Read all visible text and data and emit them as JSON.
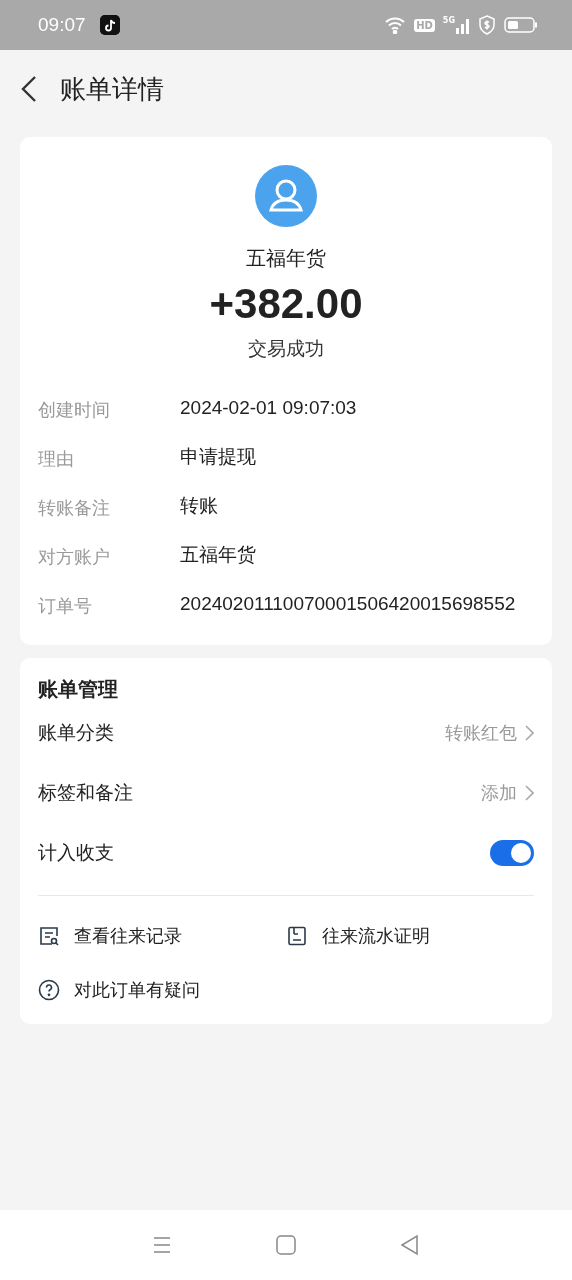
{
  "status_bar": {
    "time": "09:07",
    "hd_label": "HD",
    "network_label": "5G"
  },
  "header": {
    "title": "账单详情"
  },
  "summary": {
    "payee": "五福年货",
    "amount": "+382.00",
    "status": "交易成功"
  },
  "details": [
    {
      "label": "创建时间",
      "value": "2024-02-01 09:07:03"
    },
    {
      "label": "理由",
      "value": "申请提现"
    },
    {
      "label": "转账备注",
      "value": "转账"
    },
    {
      "label": "对方账户",
      "value": "五福年货"
    },
    {
      "label": "订单号",
      "value": "20240201110070001506420015698552"
    }
  ],
  "management": {
    "title": "账单管理",
    "rows": [
      {
        "kind": "link",
        "label": "账单分类",
        "value": "转账红包"
      },
      {
        "kind": "link",
        "label": "标签和备注",
        "value": "添加"
      },
      {
        "kind": "toggle",
        "label": "计入收支",
        "on": true
      }
    ],
    "actions": [
      {
        "kind": "records",
        "label": "查看往来记录"
      },
      {
        "kind": "statement",
        "label": "往来流水证明"
      },
      {
        "kind": "question",
        "label": "对此订单有疑问"
      }
    ]
  }
}
